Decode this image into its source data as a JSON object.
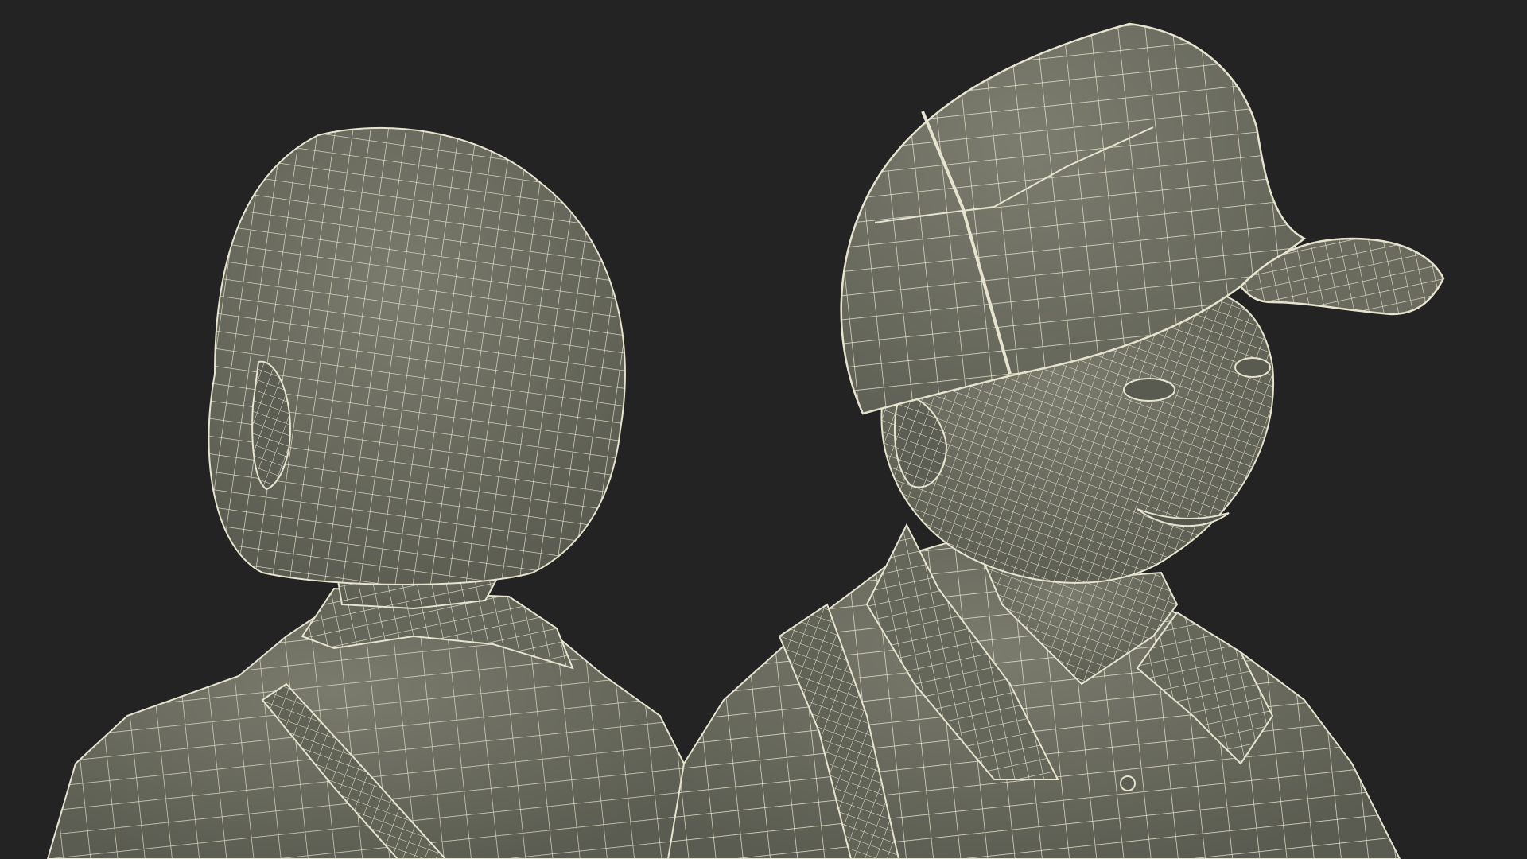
{
  "scene": {
    "background_color": "#232323",
    "model_fill_color": "#6f7063",
    "model_shadow_color": "#5e5f54",
    "wire_color": "#e6e4cf",
    "objects": [
      {
        "name": "figure-back-view",
        "icon": "wireframe-head-back"
      },
      {
        "name": "figure-front-view-with-cap",
        "icon": "wireframe-head-cap"
      }
    ]
  }
}
